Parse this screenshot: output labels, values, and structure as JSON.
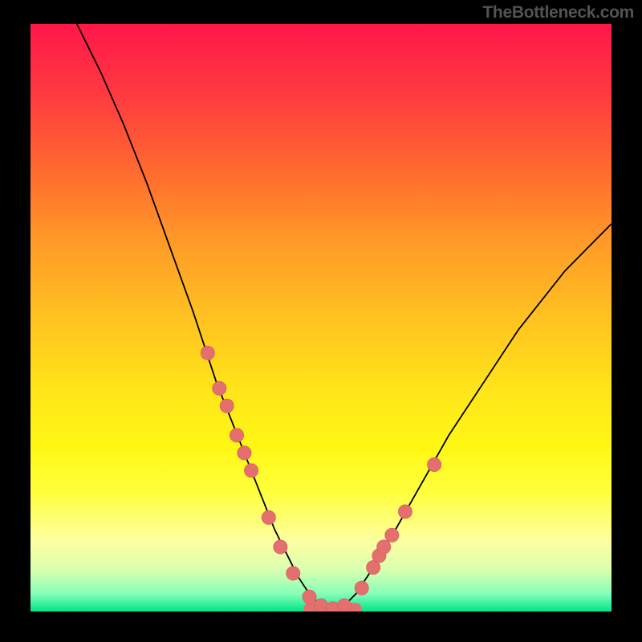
{
  "watermark": "TheBottleneck.com",
  "chart_data": {
    "type": "line",
    "title": "",
    "xlabel": "",
    "ylabel": "",
    "xlim": [
      0,
      100
    ],
    "ylim": [
      0,
      100
    ],
    "series": [
      {
        "name": "bottleneck-curve",
        "x": [
          8,
          12,
          16,
          20,
          24,
          28,
          30,
          32,
          34,
          36,
          38,
          40,
          42,
          44,
          46,
          48,
          50,
          52,
          54,
          56,
          58,
          60,
          64,
          68,
          72,
          76,
          80,
          84,
          88,
          92,
          96,
          100
        ],
        "y": [
          100,
          92,
          83,
          73,
          62,
          51,
          45,
          39,
          34,
          29,
          24,
          19,
          14,
          10,
          6,
          3,
          1,
          0,
          1,
          3,
          6,
          9,
          16,
          23,
          30,
          36,
          42,
          48,
          53,
          58,
          62,
          66
        ]
      }
    ],
    "markers": {
      "name": "highlighted-points",
      "x": [
        30.5,
        32.5,
        33.8,
        35.5,
        36.8,
        38.0,
        41.0,
        43.0,
        45.2,
        48.0,
        50.0,
        52.0,
        54.0,
        57.0,
        59.0,
        60.0,
        60.8,
        62.2,
        64.5,
        69.5
      ],
      "y": [
        44,
        38,
        35,
        30,
        27,
        24,
        16,
        11,
        6.5,
        2.5,
        1,
        0.5,
        1,
        4,
        7.5,
        9.5,
        11,
        13,
        17,
        25
      ]
    },
    "bottom_segment": {
      "x_start": 48,
      "x_end": 56,
      "y": 0.5
    },
    "colors": {
      "curve": "#000000",
      "marker": "#e46f6f",
      "gradient_top": "#ff174a",
      "gradient_bottom": "#00e489"
    }
  }
}
